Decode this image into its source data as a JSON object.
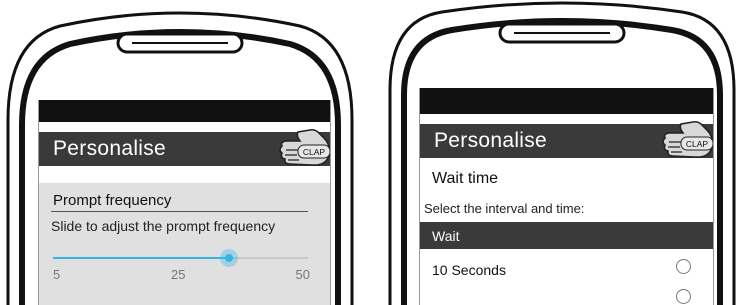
{
  "colors": {
    "appbar_bg": "#3a3a3a",
    "accent": "#33b5e5",
    "screen_bg": "#e6e6e6"
  },
  "left_screen": {
    "appbar": {
      "title": "Personalise",
      "logo_text": "CLAP",
      "logo_icon": "clapping-hand-icon"
    },
    "preference": {
      "title": "Prompt frequency",
      "summary": "Slide to adjust the prompt frequency",
      "slider": {
        "min_label": "5",
        "mid_label": "25",
        "max_label": "50",
        "min": 5,
        "max": 50,
        "value": 36
      }
    }
  },
  "right_screen": {
    "appbar": {
      "title": "Personalise",
      "logo_text": "CLAP",
      "logo_icon": "clapping-hand-icon"
    },
    "preference": {
      "title": "Wait time",
      "summary": "Select the interval and time:"
    },
    "section_header": "Wait",
    "options": [
      {
        "label": "10 Seconds",
        "selected": false
      }
    ]
  }
}
